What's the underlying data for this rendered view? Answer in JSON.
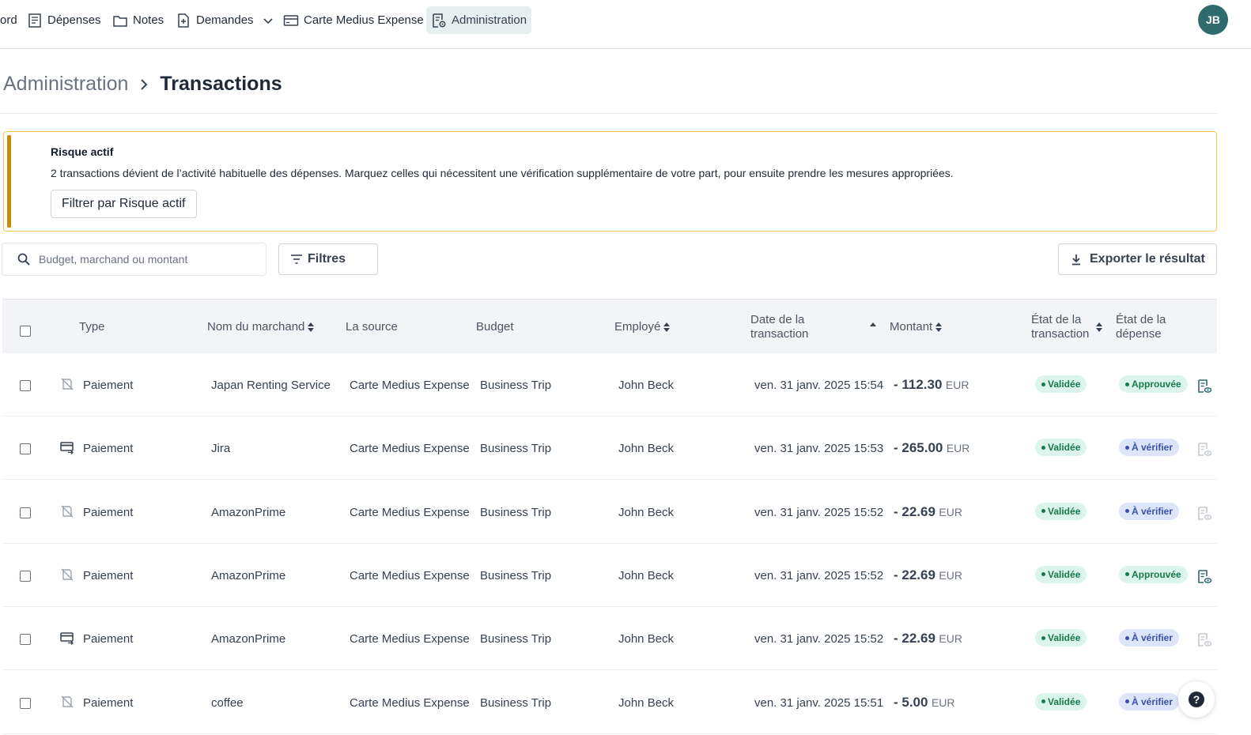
{
  "nav": {
    "items": [
      {
        "label": "ord",
        "icon": "dashboard-icon"
      },
      {
        "label": "Dépenses",
        "icon": "receipt-icon"
      },
      {
        "label": "Notes",
        "icon": "folder-icon"
      },
      {
        "label": "Demandes",
        "icon": "file-plus-icon"
      },
      {
        "label": "Carte Medius Expense",
        "icon": "credit-card-icon"
      },
      {
        "label": "Administration",
        "icon": "admin-settings-icon"
      }
    ],
    "active": "Administration",
    "avatar_initials": "JB"
  },
  "breadcrumb": {
    "root": "Administration",
    "current": "Transactions"
  },
  "alert": {
    "title": "Risque actif",
    "message": "2 transactions dévient de l’activité habituelle des dépenses. Marquez celles qui nécessitent une vérification supplémentaire de votre part, pour ensuite prendre les mesures appropriées.",
    "button": "Filtrer par Risque actif",
    "accent_color": "#c58b0a"
  },
  "toolbar": {
    "search_placeholder": "Budget, marchand ou montant",
    "filters_label": "Filtres",
    "export_label": "Exporter le résultat"
  },
  "table": {
    "headers": {
      "type": "Type",
      "merchant": "Nom du marchand",
      "source": "La source",
      "budget": "Budget",
      "employee": "Employé",
      "date_line1": "Date de la",
      "date_line2": "transaction",
      "amount": "Montant",
      "tx_state_line1": "État de la",
      "tx_state_line2": "transaction",
      "exp_state_line1": "État de la",
      "exp_state_line2": "dépense"
    },
    "rows": [
      {
        "type": "Paiement",
        "type_icon": "no-receipt-icon",
        "merchant": "Japan Renting Service",
        "source": "Carte Medius Expense",
        "budget": "Business Trip",
        "employee": "John Beck",
        "date": "ven. 31 janv. 2025 15:54",
        "amount": "- 112.30",
        "currency": "EUR",
        "tx_state": "Validée",
        "exp_state": "Approuvée",
        "exp_state_kind": "green",
        "doc_active": true
      },
      {
        "type": "Paiement",
        "type_icon": "card-transfer-icon",
        "merchant": "Jira",
        "source": "Carte Medius Expense",
        "budget": "Business Trip",
        "employee": "John Beck",
        "date": "ven. 31 janv. 2025 15:53",
        "amount": "- 265.00",
        "currency": "EUR",
        "tx_state": "Validée",
        "exp_state": "À vérifier",
        "exp_state_kind": "blue",
        "doc_active": false
      },
      {
        "type": "Paiement",
        "type_icon": "no-receipt-icon",
        "merchant": "AmazonPrime",
        "source": "Carte Medius Expense",
        "budget": "Business Trip",
        "employee": "John Beck",
        "date": "ven. 31 janv. 2025 15:52",
        "amount": "- 22.69",
        "currency": "EUR",
        "tx_state": "Validée",
        "exp_state": "À vérifier",
        "exp_state_kind": "blue",
        "doc_active": false
      },
      {
        "type": "Paiement",
        "type_icon": "no-receipt-icon",
        "merchant": "AmazonPrime",
        "source": "Carte Medius Expense",
        "budget": "Business Trip",
        "employee": "John Beck",
        "date": "ven. 31 janv. 2025 15:52",
        "amount": "- 22.69",
        "currency": "EUR",
        "tx_state": "Validée",
        "exp_state": "Approuvée",
        "exp_state_kind": "green",
        "doc_active": true
      },
      {
        "type": "Paiement",
        "type_icon": "card-transfer-icon",
        "merchant": "AmazonPrime",
        "source": "Carte Medius Expense",
        "budget": "Business Trip",
        "employee": "John Beck",
        "date": "ven. 31 janv. 2025 15:52",
        "amount": "- 22.69",
        "currency": "EUR",
        "tx_state": "Validée",
        "exp_state": "À vérifier",
        "exp_state_kind": "blue",
        "doc_active": false
      },
      {
        "type": "Paiement",
        "type_icon": "no-receipt-icon",
        "merchant": "coffee",
        "source": "Carte Medius Expense",
        "budget": "Business Trip",
        "employee": "John Beck",
        "date": "ven. 31 janv. 2025 15:51",
        "amount": "- 5.00",
        "currency": "EUR",
        "tx_state": "Validée",
        "exp_state": "À vérifier",
        "exp_state_kind": "blue",
        "doc_active": false
      }
    ]
  },
  "help": {
    "label": "?"
  },
  "colors": {
    "brand": "#2f6a6c",
    "validated_bg": "#dcf5ec",
    "validated_fg": "#167a4e",
    "review_bg": "#dde5fb",
    "review_fg": "#3b4fb0"
  }
}
